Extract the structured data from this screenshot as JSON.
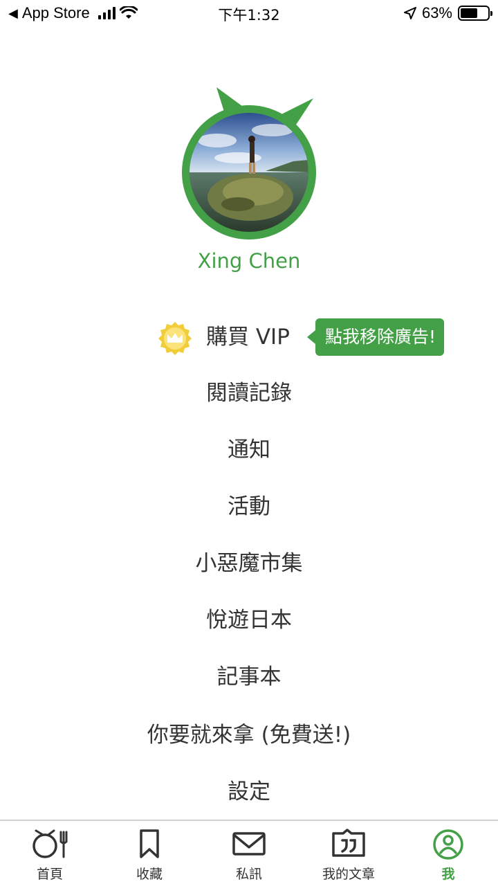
{
  "status_bar": {
    "back_app": "App Store",
    "time": "下午1:32",
    "battery_percent": "63%",
    "battery_level": 0.63,
    "icons": [
      "back-arrow-icon",
      "cellular-signal-icon",
      "wifi-icon",
      "location-arrow-icon",
      "battery-icon"
    ]
  },
  "profile": {
    "name": "Xing Chen",
    "avatar": "profile-photo"
  },
  "vip": {
    "label": "購買 VIP",
    "tooltip": "點我移除廣告!",
    "icon": "crown-badge-icon"
  },
  "menu": {
    "items": [
      {
        "label": "閱讀記錄"
      },
      {
        "label": "通知"
      },
      {
        "label": "活動"
      },
      {
        "label": "小惡魔市集"
      },
      {
        "label": "悅遊日本"
      },
      {
        "label": "記事本"
      },
      {
        "label": "你要就來拿 (免費送!)"
      },
      {
        "label": "設定"
      }
    ]
  },
  "tabs": [
    {
      "label": "首頁",
      "icon": "home-devil-icon",
      "active": false
    },
    {
      "label": "收藏",
      "icon": "bookmark-icon",
      "active": false
    },
    {
      "label": "私訊",
      "icon": "mail-icon",
      "active": false
    },
    {
      "label": "我的文章",
      "icon": "quote-article-icon",
      "active": false
    },
    {
      "label": "我",
      "icon": "profile-devil-icon",
      "active": true
    }
  ],
  "colors": {
    "brand_green": "#43a047",
    "text": "#333333",
    "crown_yellow": "#f2cd3a"
  }
}
